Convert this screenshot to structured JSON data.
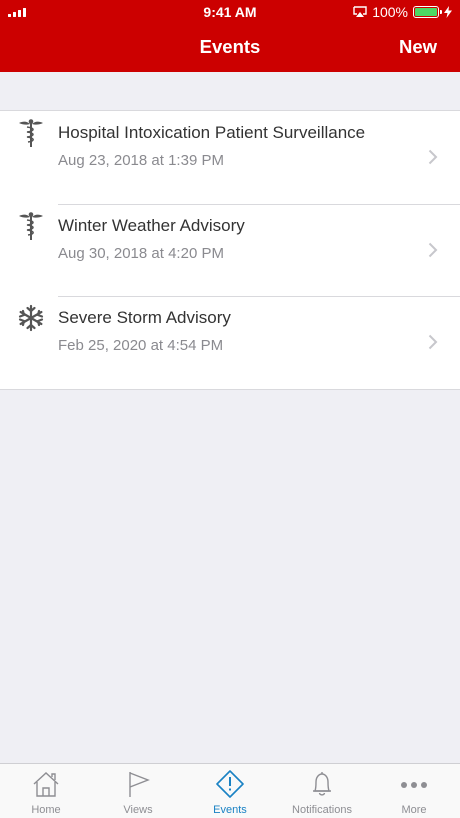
{
  "status_bar": {
    "time": "9:41 AM",
    "battery_percent": "100%",
    "battery_level": 1.0,
    "icons": [
      "signal-icon",
      "airplay-icon",
      "battery-icon",
      "charging-bolt-icon"
    ]
  },
  "nav": {
    "title": "Events",
    "action_label": "New",
    "bar_color": "#cc0000"
  },
  "events": [
    {
      "title": "Hospital Intoxication Patient Surveillance",
      "date": "Aug 23, 2018 at 1:39 PM",
      "icon": "caduceus-icon"
    },
    {
      "title": "Winter Weather Advisory",
      "date": "Aug 30, 2018 at 4:20 PM",
      "icon": "caduceus-icon"
    },
    {
      "title": "Severe Storm Advisory",
      "date": "Feb 25, 2020 at 4:54 PM",
      "icon": "snowflake-icon"
    }
  ],
  "tab_bar": {
    "active_color": "#1a82c4",
    "tabs": [
      {
        "label": "Home",
        "icon": "home-icon",
        "active": false
      },
      {
        "label": "Views",
        "icon": "flag-icon",
        "active": false
      },
      {
        "label": "Events",
        "icon": "alert-diamond-icon",
        "active": true
      },
      {
        "label": "Notifications",
        "icon": "bell-icon",
        "active": false
      },
      {
        "label": "More",
        "icon": "more-dots-icon",
        "active": false
      }
    ]
  }
}
